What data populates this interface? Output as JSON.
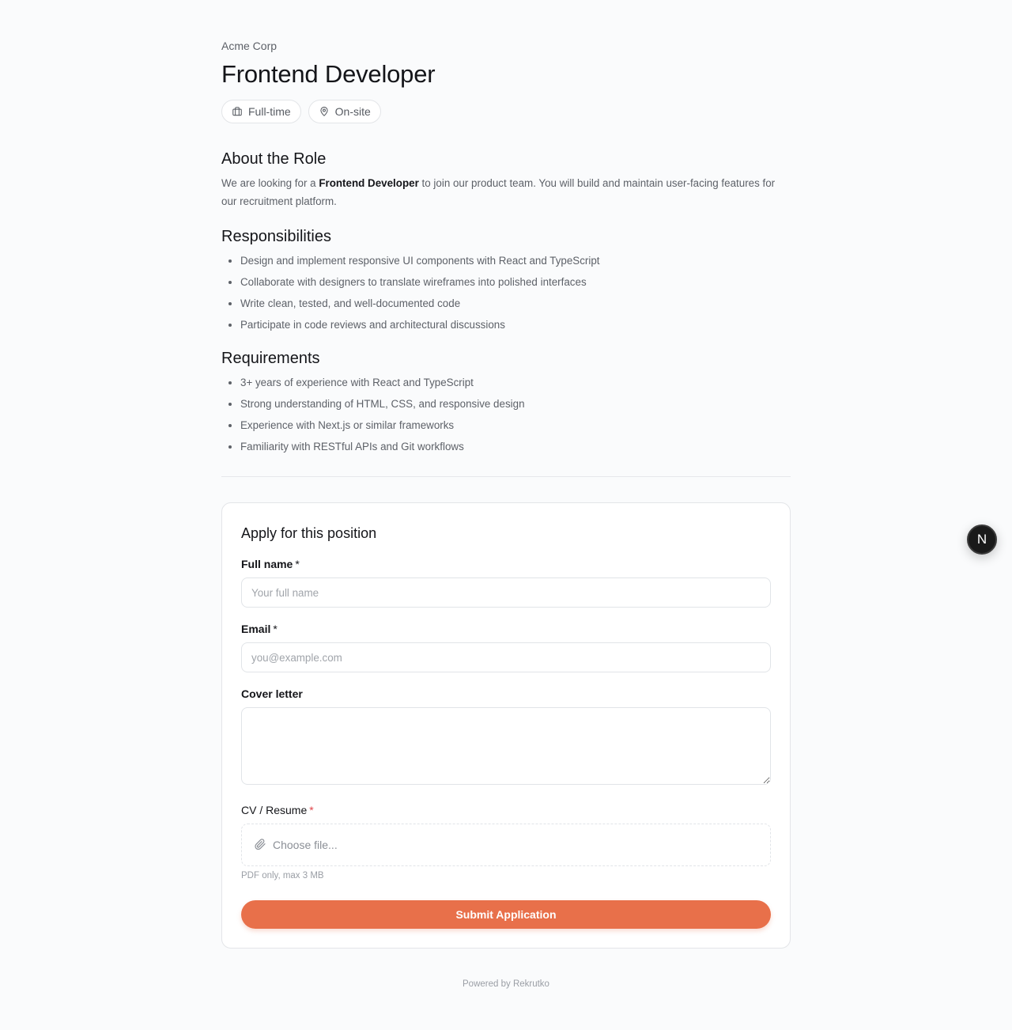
{
  "job": {
    "company": "Acme Corp",
    "title": "Frontend Developer",
    "tags": {
      "employment_type": "Full-time",
      "location_type": "On-site"
    }
  },
  "about": {
    "heading": "About the Role",
    "text_before": "We are looking for a ",
    "text_bold": "Frontend Developer",
    "text_after": " to join our product team. You will build and maintain user-facing features for our recruitment platform."
  },
  "responsibilities": {
    "heading": "Responsibilities",
    "items": [
      "Design and implement responsive UI components with React and TypeScript",
      "Collaborate with designers to translate wireframes into polished interfaces",
      "Write clean, tested, and well-documented code",
      "Participate in code reviews and architectural discussions"
    ]
  },
  "requirements": {
    "heading": "Requirements",
    "items": [
      "3+ years of experience with React and TypeScript",
      "Strong understanding of HTML, CSS, and responsive design",
      "Experience with Next.js or similar frameworks",
      "Familiarity with RESTful APIs and Git workflows"
    ]
  },
  "form": {
    "title": "Apply for this position",
    "full_name": {
      "label": "Full name",
      "required_mark": "*",
      "placeholder": "Your full name",
      "value": ""
    },
    "email": {
      "label": "Email",
      "required_mark": "*",
      "placeholder": "you@example.com",
      "value": ""
    },
    "cover_letter": {
      "label": "Cover letter",
      "value": ""
    },
    "cv": {
      "label": "CV / Resume",
      "required_mark": "*",
      "choose_label": "Choose file...",
      "hint": "PDF only, max 3 MB"
    },
    "submit_label": "Submit Application"
  },
  "footer": {
    "text": "Powered by Rekrutko"
  },
  "fab": {
    "letter": "N"
  },
  "colors": {
    "accent": "#e8704a",
    "required_red": "#e0454a",
    "background": "#fafbfc"
  },
  "icons": {
    "employment_type": "briefcase-icon",
    "location_type": "map-pin-icon",
    "file": "paperclip-icon"
  }
}
